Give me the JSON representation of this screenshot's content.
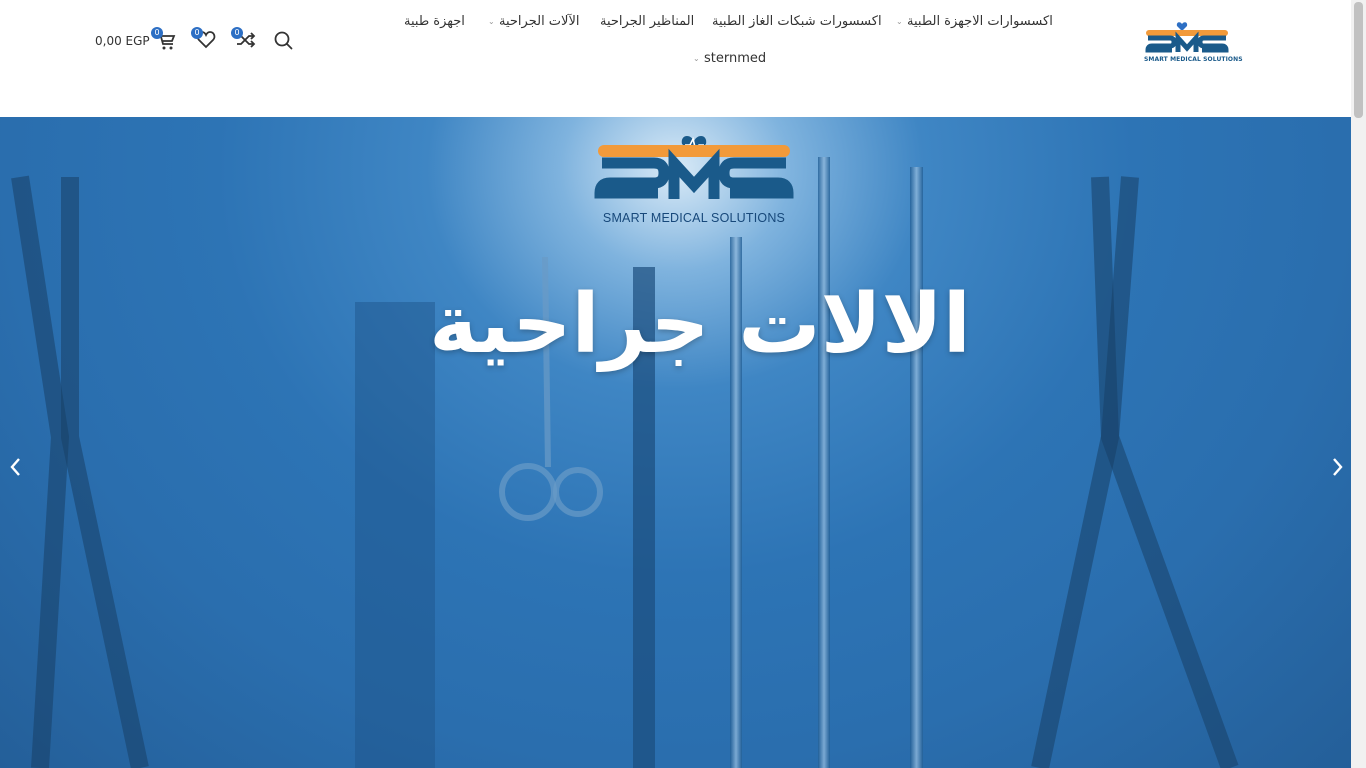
{
  "header": {
    "logo_text": "SMART MEDICAL SOLUTIONS",
    "nav": [
      {
        "label": "اكسسوارات الاجهزة الطبية",
        "has_dropdown": true
      },
      {
        "label": "اكسسورات شبكات الغاز الطبية",
        "has_dropdown": false
      },
      {
        "label": "المناظير الجراحية",
        "has_dropdown": false
      },
      {
        "label": "الآلات الجراحية",
        "has_dropdown": true
      },
      {
        "label": "اجهزة طبية",
        "has_dropdown": false
      },
      {
        "label": "sternmed",
        "has_dropdown": true
      }
    ],
    "tools": {
      "search_icon": "search-icon",
      "compare_count": "0",
      "wishlist_count": "0",
      "cart_count": "0",
      "cart_total": "0,00 EGP"
    }
  },
  "hero": {
    "logo_text": "SMART MEDICAL SOLUTIONS",
    "title": "الالات جراحية",
    "prev_icon": "chevron-left-icon",
    "next_icon": "chevron-right-icon"
  },
  "colors": {
    "brand_orange": "#f29a3a",
    "brand_blue": "#1a5a8a",
    "badge_blue": "#2d6fc4",
    "hero_blue": "#2d74b5"
  }
}
